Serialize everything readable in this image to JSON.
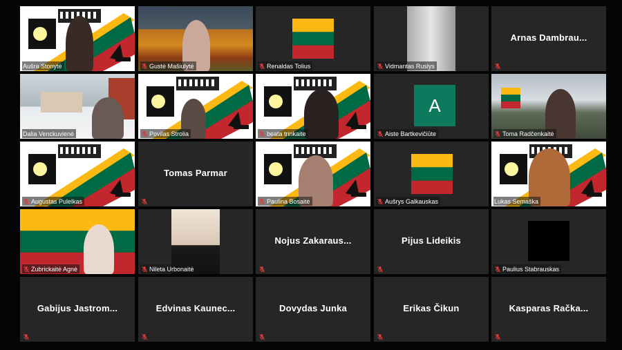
{
  "participants": {
    "r1c1": {
      "name": "Aušra Stonytė"
    },
    "r1c2": {
      "name": "Gustė Mašiulytė"
    },
    "r1c3": {
      "name": "Renaldas Tolius"
    },
    "r1c4": {
      "name": "Vidmantas Ruslys"
    },
    "r1c5": {
      "display_name": "Arnas  Dambrau..."
    },
    "r2c1": {
      "name": "Dalia Venckuvienė"
    },
    "r2c2": {
      "name": "Povilas Strolia"
    },
    "r2c3": {
      "name": "beata trinkaite"
    },
    "r2c4": {
      "name": "Aiste Bartkevičiūte",
      "avatar_letter": "A"
    },
    "r2c5": {
      "name": "Toma Radčenkaitė"
    },
    "r3c1": {
      "name": "Augustas Pulelkas"
    },
    "r3c2": {
      "display_name": "Tomas Parmar"
    },
    "r3c3": {
      "name": "Paulina Bosaitė"
    },
    "r3c4": {
      "name": "Aušrys Galkauskas"
    },
    "r3c5": {
      "name": "Lukas Semaška"
    },
    "r4c1": {
      "name": "Zubrickaitė Agnė"
    },
    "r4c2": {
      "name": "Nileta Urbonaitė"
    },
    "r4c3": {
      "display_name": "Nojus  Zakaraus..."
    },
    "r4c4": {
      "display_name": "Pijus Lideikis"
    },
    "r4c5": {
      "name": "Paulius Stabrauskas"
    },
    "r5c1": {
      "display_name": "Gabijus  Jastrom..."
    },
    "r5c2": {
      "display_name": "Edvinas  Kaunec..."
    },
    "r5c3": {
      "display_name": "Dovydas Junka"
    },
    "r5c4": {
      "display_name": "Erikas Čikun"
    },
    "r5c5": {
      "display_name": "Kasparas  Račka..."
    }
  },
  "colors": {
    "tile_bg": "#262626",
    "active_speaker_outline": "#e8e23a",
    "muted_icon": "#e03b3b",
    "flag_yellow": "#fdb913",
    "flag_green": "#006a44",
    "flag_red": "#c1272d",
    "avatar_green": "#0d7a5d"
  },
  "icons": {
    "muted": "microphone-muted-icon"
  }
}
